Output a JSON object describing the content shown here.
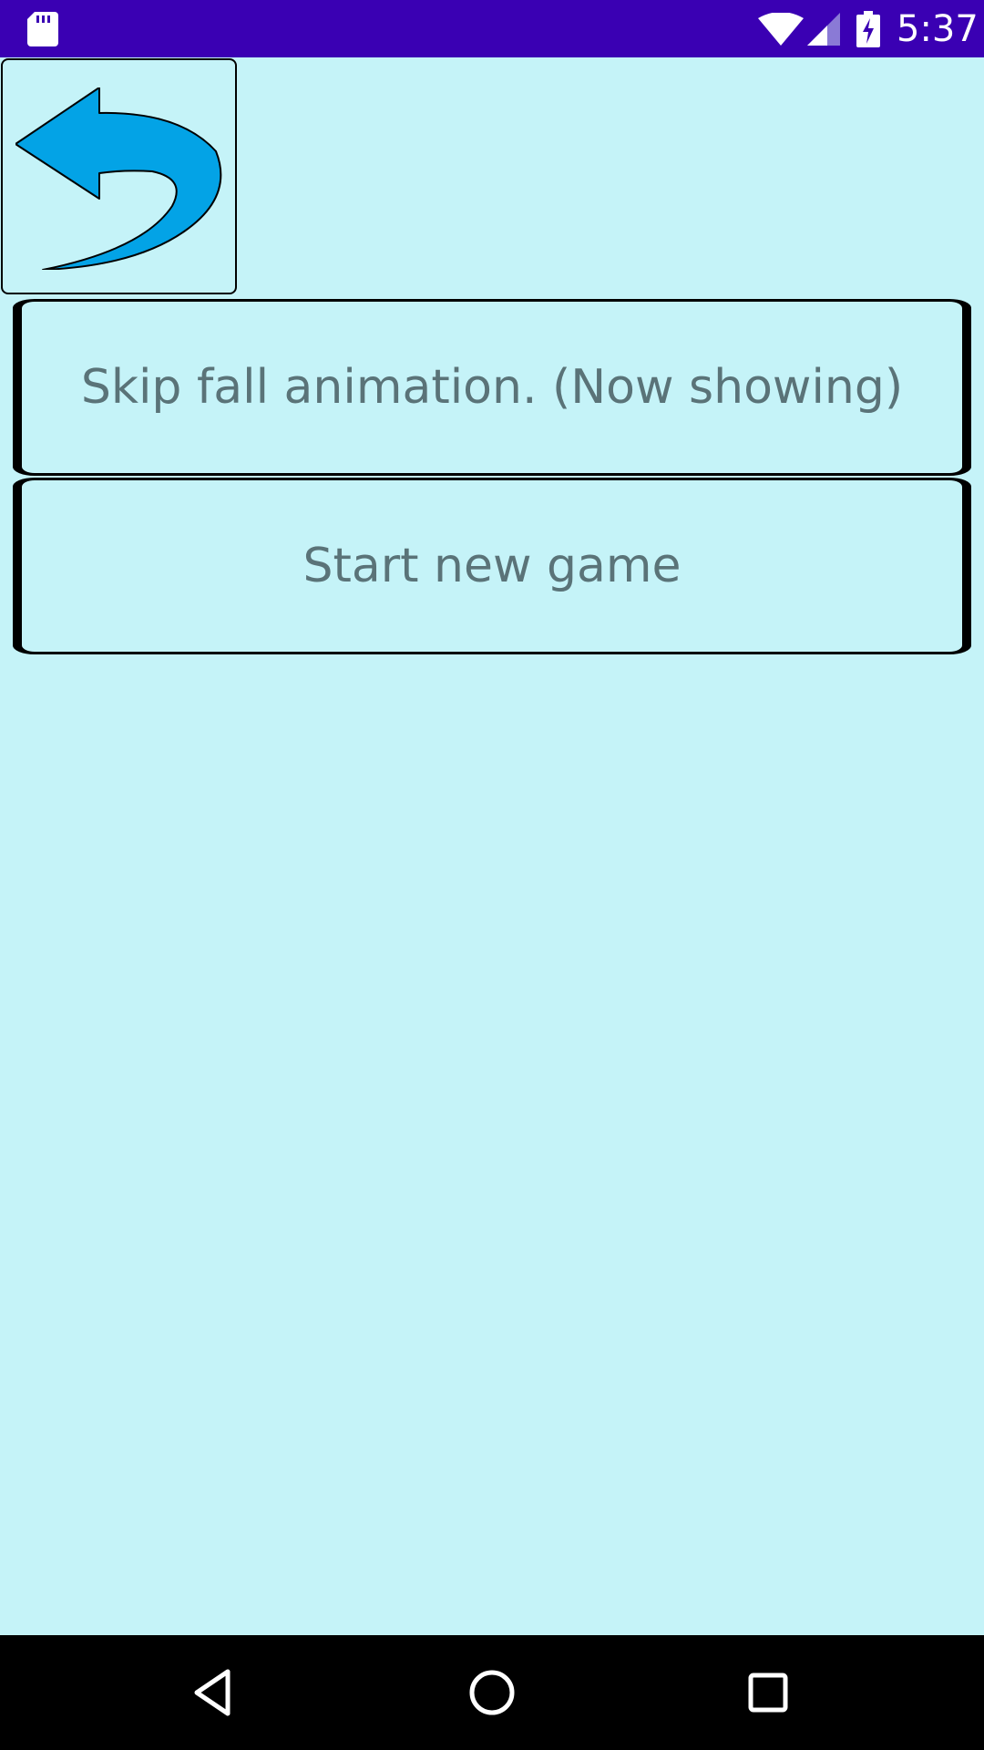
{
  "status_bar": {
    "time": "5:37",
    "color": "#3a00b3",
    "icons": [
      "sd-card-icon",
      "wifi-icon",
      "signal-icon",
      "battery-charging-icon"
    ]
  },
  "back_button": {
    "icon": "undo-arrow-icon",
    "icon_color": "#03a3e6"
  },
  "menu": {
    "items": [
      {
        "label": "Skip fall animation. (Now showing)"
      },
      {
        "label": "Start new game"
      }
    ]
  },
  "nav_bar": {
    "icons": [
      "back-triangle-icon",
      "home-circle-icon",
      "recents-square-icon"
    ]
  },
  "colors": {
    "background": "#c5f3f8",
    "button_text": "#5a7378"
  }
}
